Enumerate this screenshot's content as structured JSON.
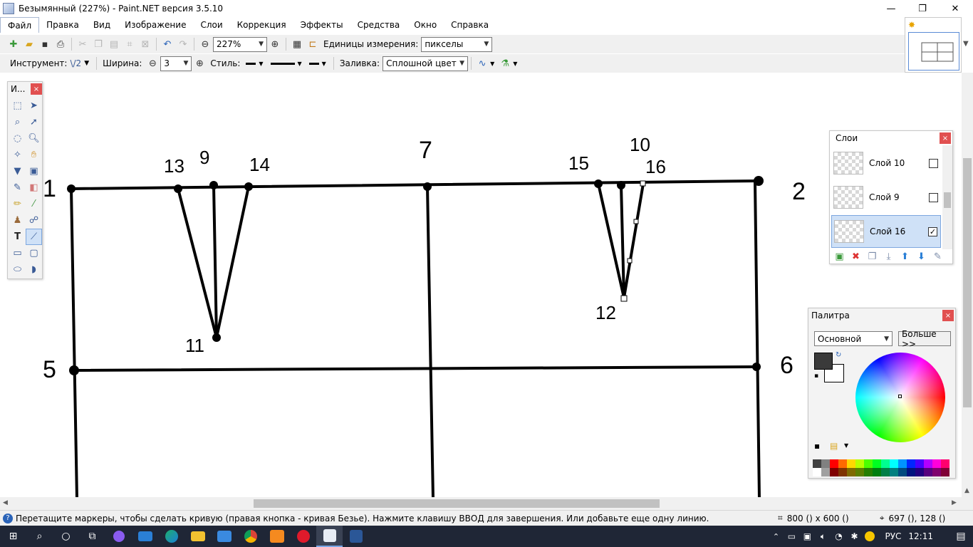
{
  "window": {
    "title": "Безымянный (227%) - Paint.NET версия 3.5.10",
    "minimize": "—",
    "restore": "❐",
    "close": "✕"
  },
  "menu": [
    "Файл",
    "Правка",
    "Вид",
    "Изображение",
    "Слои",
    "Коррекция",
    "Эффекты",
    "Средства",
    "Окно",
    "Справка"
  ],
  "toolbar": {
    "zoom_value": "227%",
    "units_label": "Единицы измерения:",
    "units_value": "пикселы"
  },
  "tool_options": {
    "tool_label": "Инструмент:",
    "tool_glyph": "\\/2",
    "width_label": "Ширина:",
    "width_value": "3",
    "style_label": "Стиль:",
    "fill_label": "Заливка:",
    "fill_value": "Сплошной цвет"
  },
  "tools_panel": {
    "title": "И...",
    "close": "×"
  },
  "layers_panel": {
    "title": "Слои",
    "close": "×",
    "layers": [
      {
        "name": "Слой 10",
        "visible": false,
        "selected": false
      },
      {
        "name": "Слой 9",
        "visible": false,
        "selected": false
      },
      {
        "name": "Слой 16",
        "visible": true,
        "selected": true
      }
    ]
  },
  "palette_panel": {
    "title": "Палитра",
    "close": "×",
    "palette_select": "Основной",
    "more_button": "Больше >>",
    "primary_color": "#3a3a3a",
    "secondary_color": "#ffffff",
    "swatches_top": [
      "#404040",
      "#808080",
      "#ff0000",
      "#ff6a00",
      "#ffd800",
      "#b6ff00",
      "#4cff00",
      "#00ff21",
      "#00ff90",
      "#00ffff",
      "#0094ff",
      "#0026ff",
      "#4800ff",
      "#b200ff",
      "#ff00dc",
      "#ff006e"
    ],
    "swatches_bottom": [
      "#ffffff",
      "#a0a0a0",
      "#7f0000",
      "#7f3300",
      "#7f6a00",
      "#5b7f00",
      "#267f00",
      "#007f0e",
      "#007f46",
      "#007f7f",
      "#004a7f",
      "#00137f",
      "#21007f",
      "#57007f",
      "#7f006e",
      "#7f0037"
    ]
  },
  "drawing": {
    "labels": [
      {
        "id": "1",
        "text": "1"
      },
      {
        "id": "2",
        "text": "2"
      },
      {
        "id": "5",
        "text": "5"
      },
      {
        "id": "6",
        "text": "6"
      },
      {
        "id": "7",
        "text": "7"
      },
      {
        "id": "9",
        "text": "9"
      },
      {
        "id": "10",
        "text": "10"
      },
      {
        "id": "11",
        "text": "11"
      },
      {
        "id": "12",
        "text": "12"
      },
      {
        "id": "13",
        "text": "13"
      },
      {
        "id": "14",
        "text": "14"
      },
      {
        "id": "15",
        "text": "15"
      },
      {
        "id": "16",
        "text": "16"
      }
    ]
  },
  "status": {
    "message": "Перетащите маркеры, чтобы сделать кривую (правая кнопка - кривая Безье). Нажмите клавишу ВВОД для завершения. Или добавьте еще одну линию.",
    "image_size": "800 () x 600 ()",
    "cursor_pos": "697 (), 128 ()"
  },
  "taskbar": {
    "lang": "РУС",
    "time": "12:11"
  }
}
